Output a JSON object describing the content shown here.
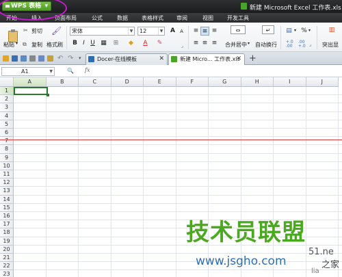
{
  "app": {
    "menu_label": "WPS 表格",
    "menu_arrow": "▾",
    "window_title": "新建 Microsoft Excel 工作表.xls - WP"
  },
  "menu": {
    "items": [
      "开始",
      "插入",
      "页面布局",
      "公式",
      "数据",
      "表格样式",
      "审阅",
      "视图",
      "开发工具"
    ]
  },
  "ribbon": {
    "paste": "粘贴",
    "paste_arrow": "▾",
    "cut": "剪切",
    "copy": "复制",
    "format_painter": "格式刷",
    "font_name": "宋体",
    "font_size": "12",
    "bold": "B",
    "italic": "I",
    "underline": "U",
    "grow_font": "A",
    "shrink_font": "A",
    "merge_center": "合并居中",
    "wrap_text": "自动换行",
    "percent": "%",
    "comma": "000",
    "decimal_inc": "+.0 .00",
    "decimal_dec": ".00 +.0",
    "highlight_more": "突出显"
  },
  "tabs": {
    "items": [
      {
        "label": "Docer-在线模板"
      },
      {
        "label": "新建 Micro... 工作表.xls"
      }
    ],
    "new_tab": "+",
    "close": "✕"
  },
  "formula_bar": {
    "cell_ref": "A1",
    "fx": "fx",
    "value": ""
  },
  "sheet": {
    "columns": [
      "A",
      "B",
      "C",
      "D",
      "E",
      "F",
      "G",
      "H",
      "I",
      "J"
    ],
    "rows": [
      "1",
      "2",
      "3",
      "4",
      "5",
      "6",
      "7",
      "8",
      "9",
      "10",
      "11",
      "12",
      "13",
      "14",
      "15",
      "16",
      "17",
      "18",
      "19",
      "20",
      "21",
      "22",
      "23"
    ],
    "selected_cell": "A1"
  },
  "watermark": {
    "line1": "技术员联盟",
    "line2": "www.jsgho.com",
    "right1": "51.ne",
    "right2": "之家",
    "right3": "lia"
  },
  "colors": {
    "highlight": "#c91bd1",
    "wps_green": "#4f9a24",
    "red_line": "#e23a3a",
    "selection": "#2b7a2b"
  }
}
